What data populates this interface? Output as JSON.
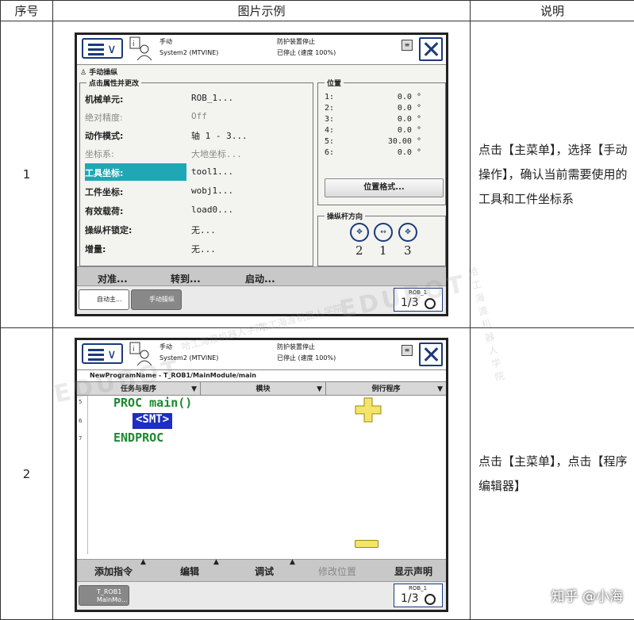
{
  "table": {
    "headers": [
      "序号",
      "图片示例",
      "说明"
    ],
    "rows": [
      {
        "num": "1",
        "desc": "点击【主菜单】，选择【手动操作】，确认当前需要使用的工具和工件坐标系"
      },
      {
        "num": "2",
        "desc": "点击【主菜单】，点击【程序编辑器】"
      }
    ]
  },
  "pendant": {
    "status_mode": "手动",
    "status_system": "System2 (MTVINE)",
    "status_guard": "防护装置停止",
    "status_speed": "已停止 (速度 100%)",
    "quick_robot": "ROB_1",
    "quick_fraction": "1/3"
  },
  "jog": {
    "tab_title": "手动操纵",
    "props_group_title": "点击属性并更改",
    "props": [
      {
        "label": "机械单元:",
        "value": "ROB_1...",
        "dim": false
      },
      {
        "label": "绝对精度:",
        "value": "Off",
        "dim": true
      },
      {
        "label": "动作模式:",
        "value": "轴 1 - 3...",
        "dim": false
      },
      {
        "label": "坐标系:",
        "value": "大地坐标...",
        "dim": true
      },
      {
        "label": "工具坐标:",
        "value": "tool1...",
        "dim": false
      },
      {
        "label": "工件坐标:",
        "value": "wobj1...",
        "dim": false
      },
      {
        "label": "有效载荷:",
        "value": "load0...",
        "dim": false
      },
      {
        "label": "操纵杆锁定:",
        "value": "无...",
        "dim": false
      },
      {
        "label": "增量:",
        "value": "无...",
        "dim": false
      }
    ],
    "position_group_title": "位置",
    "positions": [
      {
        "axis": "1:",
        "value": "0.0 °"
      },
      {
        "axis": "2:",
        "value": "0.0 °"
      },
      {
        "axis": "3:",
        "value": "0.0 °"
      },
      {
        "axis": "4:",
        "value": "0.0 °"
      },
      {
        "axis": "5:",
        "value": "30.00 °"
      },
      {
        "axis": "6:",
        "value": "0.0 °"
      }
    ],
    "position_format_button": "位置格式...",
    "joystick_group_title": "操纵杆方向",
    "joystick_numbers": [
      "2",
      "1",
      "3"
    ],
    "commands": [
      "对准...",
      "转到...",
      "启动..."
    ],
    "tasks": [
      "自动主...",
      "手动操纵"
    ]
  },
  "editor": {
    "path": "NewProgramName - T_ROB1/MainModule/main",
    "tabs": [
      "任务与程序",
      "模块",
      "例行程序"
    ],
    "lines": [
      {
        "num": "5",
        "text": "PROC main()"
      },
      {
        "num": "6",
        "text": "<SMT>"
      },
      {
        "num": "7",
        "text": "ENDPROC"
      }
    ],
    "commands": [
      "添加指令",
      "编辑",
      "调试",
      "修改位置",
      "显示声明"
    ],
    "task": "T_ROB1 MainMo..."
  },
  "watermark": {
    "brand": "EDUBOT",
    "school": "哈工海渡机器人学院",
    "zhihu": "知乎 @小海"
  }
}
